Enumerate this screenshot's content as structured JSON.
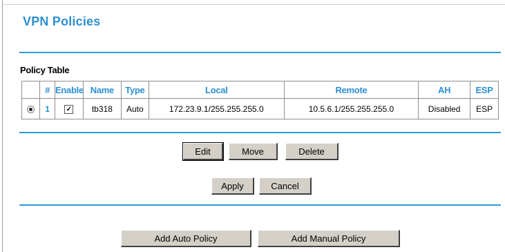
{
  "page": {
    "title": "VPN Policies"
  },
  "policy_table": {
    "title": "Policy Table",
    "columns": [
      "",
      "#",
      "Enable",
      "Name",
      "Type",
      "Local",
      "Remote",
      "AH",
      "ESP"
    ],
    "rows": [
      {
        "selected": true,
        "number": "1",
        "enabled": true,
        "check_glyph": "✓",
        "name": "tb318",
        "type": "Auto",
        "local": "172.23.9.1/255.255.255.0",
        "remote": "10.5.6.1/255.255.255.0",
        "ah": "Disabled",
        "esp": "ESP"
      }
    ]
  },
  "row_actions": {
    "edit": "Edit",
    "move": "Move",
    "delete": "Delete"
  },
  "form_actions": {
    "apply": "Apply",
    "cancel": "Cancel"
  },
  "add_actions": {
    "auto": "Add Auto Policy",
    "manual": "Add Manual Policy"
  },
  "colors": {
    "accent": "#2d8fd0",
    "rule": "#2d9ad6",
    "button_face": "#d4d0c8"
  }
}
